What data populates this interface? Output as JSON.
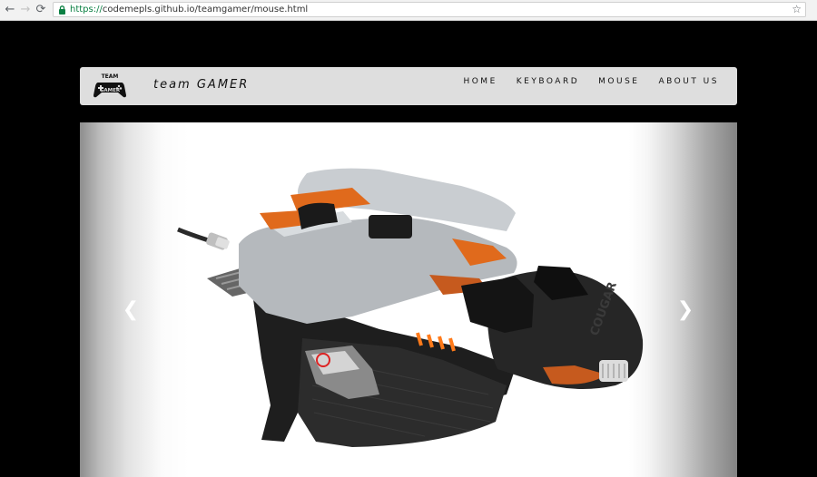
{
  "browser": {
    "url_scheme": "https://",
    "url_rest": "codemepls.github.io/teamgamer/mouse.html"
  },
  "navbar": {
    "logo_line1": "TEAM",
    "logo_line2": "GAMER",
    "brand": "team GAMER",
    "links": [
      "HOME",
      "KEYBOARD",
      "MOUSE",
      "ABOUT US"
    ]
  },
  "carousel": {
    "product_logo": "COUGAR",
    "prev_icon": "chevron-left-icon",
    "next_icon": "chevron-right-icon",
    "prev_glyph": "❮",
    "next_glyph": "❯"
  }
}
